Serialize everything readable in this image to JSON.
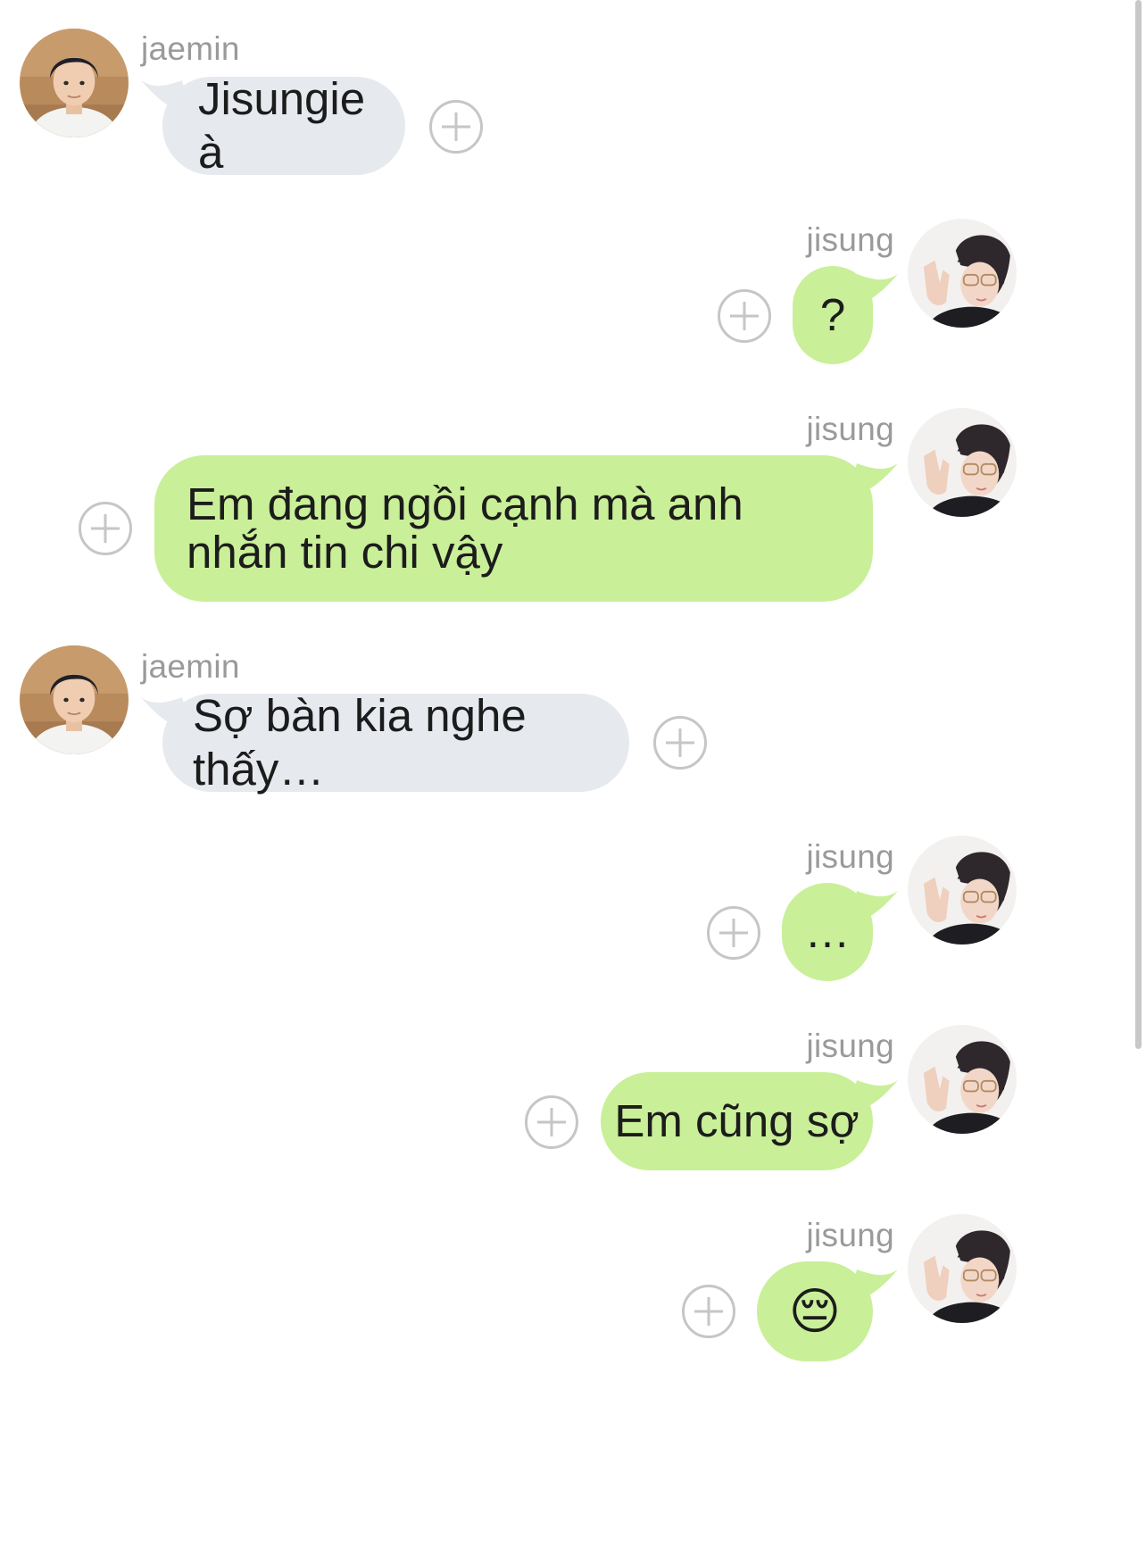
{
  "messages": [
    {
      "sender": "jaemin",
      "text": "Jisungie à"
    },
    {
      "sender": "jisung",
      "text": "?"
    },
    {
      "sender": "jisung",
      "text": "Em đang ngồi cạnh mà anh nhắn tin chi vậy"
    },
    {
      "sender": "jaemin",
      "text": "Sợ bàn kia nghe thấy…"
    },
    {
      "sender": "jisung",
      "text": "…"
    },
    {
      "sender": "jisung",
      "text": "Em cũng sợ"
    },
    {
      "sender": "jisung",
      "text": "😔"
    }
  ],
  "colors": {
    "incoming_bubble": "#e6e9ee",
    "outgoing_bubble": "#c9ef98",
    "name_text": "#9a9a9a",
    "plus_icon": "#c6c6c6"
  },
  "icons": {
    "add_reaction": "plus-circle-icon",
    "avatar_jaemin": "avatar",
    "avatar_jisung": "avatar"
  }
}
